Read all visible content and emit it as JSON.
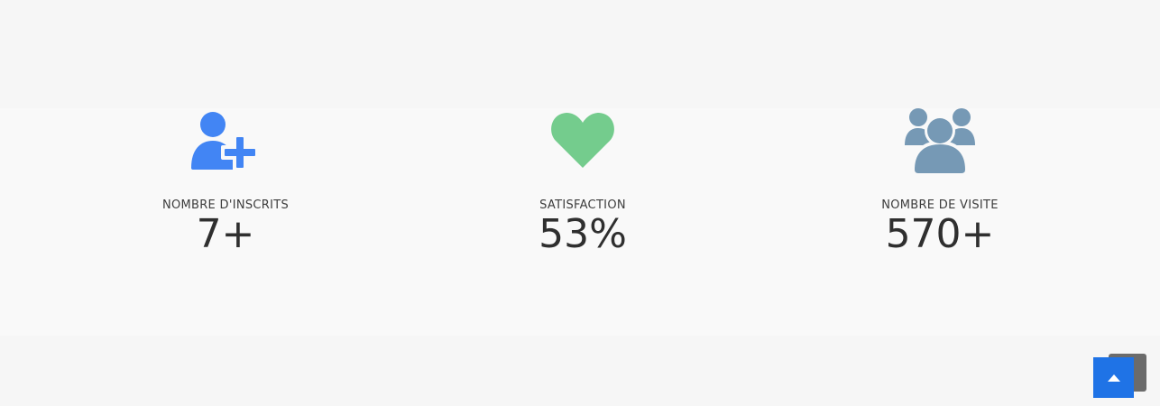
{
  "stats": [
    {
      "icon": "user-plus-icon",
      "label": "NOMBRE D'INSCRITS",
      "value": "7+",
      "color": "#4285f4"
    },
    {
      "icon": "heart-icon",
      "label": "SATISFACTION",
      "value": "53%",
      "color": "#74cc8d"
    },
    {
      "icon": "users-group-icon",
      "label": "NOMBRE DE VISITE",
      "value": "570+",
      "color": "#7699b5"
    }
  ],
  "scroll_top": {
    "icon": "caret-up-icon",
    "color": "#1f73e6"
  }
}
